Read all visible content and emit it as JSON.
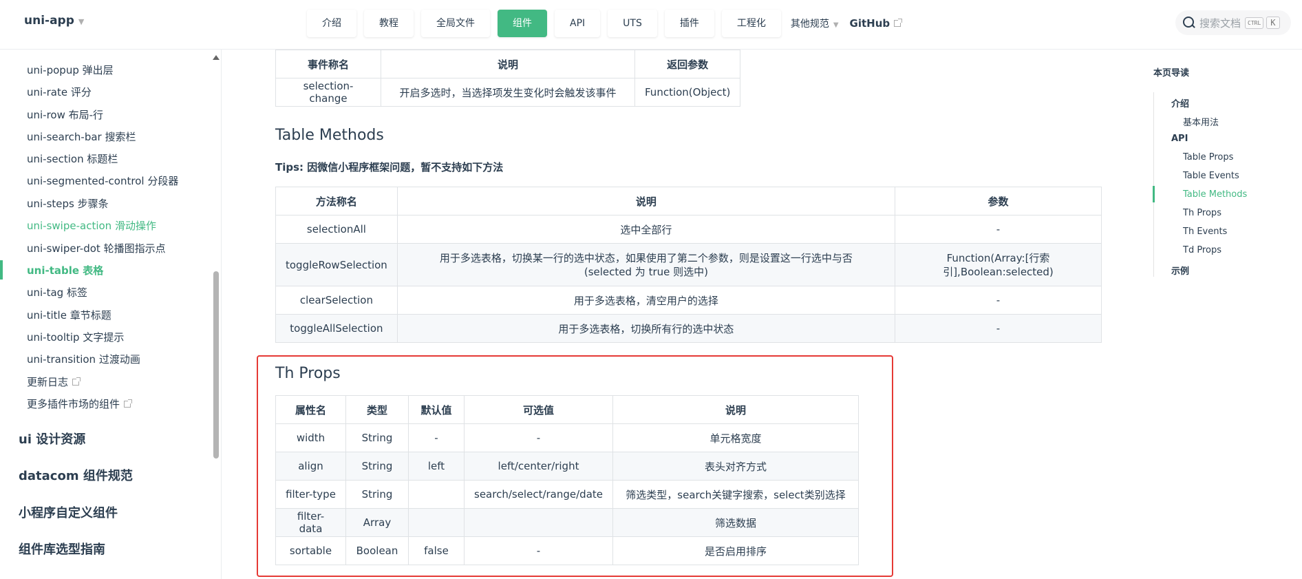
{
  "brand": {
    "name": "uni-app"
  },
  "nav": {
    "items": [
      {
        "label": "介绍"
      },
      {
        "label": "教程"
      },
      {
        "label": "全局文件"
      },
      {
        "label": "组件",
        "active": true
      },
      {
        "label": "API"
      },
      {
        "label": "UTS"
      },
      {
        "label": "插件"
      },
      {
        "label": "工程化"
      }
    ],
    "other_label": "其他规范",
    "github_label": "GitHub"
  },
  "search": {
    "placeholder": "搜索文档",
    "kbd_ctrl": "CTRL",
    "kbd_k": "K"
  },
  "sidebar": {
    "items": [
      "uni-popup 弹出层",
      "uni-rate 评分",
      "uni-row 布局-行",
      "uni-search-bar 搜索栏",
      "uni-section 标题栏",
      "uni-segmented-control 分段器",
      "uni-steps 步骤条",
      "uni-swipe-action 滑动操作",
      "uni-swiper-dot 轮播图指示点",
      "uni-table 表格",
      "uni-tag 标签",
      "uni-title 章节标题",
      "uni-tooltip 文字提示",
      "uni-transition 过渡动画",
      "更新日志",
      "更多插件市场的组件"
    ],
    "groups": [
      "ui 设计资源",
      "datacom 组件规范",
      "小程序自定义组件",
      "组件库选型指南"
    ]
  },
  "events_table": {
    "headers": [
      "事件称名",
      "说明",
      "返回参数"
    ],
    "rows": [
      [
        "selection-change",
        "开启多选时，当选择项发生变化时会触发该事件",
        "Function(Object)"
      ]
    ]
  },
  "methods": {
    "heading": "Table Methods",
    "tips": "Tips: 因微信小程序框架问题，暂不支持如下方法",
    "headers": [
      "方法称名",
      "说明",
      "参数"
    ],
    "rows": [
      [
        "selectionAll",
        "选中全部行",
        "-"
      ],
      [
        "toggleRowSelection",
        "用于多选表格，切换某一行的选中状态，如果使用了第二个参数，则是设置这一行选中与否(selected 为 true 则选中)",
        "Function(Array:[行索引],Boolean:selected)"
      ],
      [
        "clearSelection",
        "用于多选表格，清空用户的选择",
        "-"
      ],
      [
        "toggleAllSelection",
        "用于多选表格，切换所有行的选中状态",
        "-"
      ]
    ]
  },
  "th_props": {
    "heading": "Th Props",
    "headers": [
      "属性名",
      "类型",
      "默认值",
      "可选值",
      "说明"
    ],
    "rows": [
      [
        "width",
        "String",
        "-",
        "-",
        "单元格宽度"
      ],
      [
        "align",
        "String",
        "left",
        "left/center/right",
        "表头对齐方式"
      ],
      [
        "filter-type",
        "String",
        "",
        "search/select/range/date",
        "筛选类型，search关键字搜索，select类别选择"
      ],
      [
        "filter-data",
        "Array",
        "",
        "",
        "筛选数据"
      ],
      [
        "sortable",
        "Boolean",
        "false",
        "-",
        "是否启用排序"
      ]
    ]
  },
  "toc": {
    "title": "本页导读",
    "items": [
      {
        "label": "介绍",
        "level": 1
      },
      {
        "label": "基本用法",
        "level": 2
      },
      {
        "label": "API",
        "level": 1
      },
      {
        "label": "Table Props",
        "level": 2
      },
      {
        "label": "Table Events",
        "level": 2
      },
      {
        "label": "Table Methods",
        "level": 2,
        "active": true
      },
      {
        "label": "Th Props",
        "level": 2
      },
      {
        "label": "Th Events",
        "level": 2
      },
      {
        "label": "Td Props",
        "level": 2
      },
      {
        "label": "示例",
        "level": 1
      }
    ]
  },
  "colors": {
    "accent": "#42b983",
    "highlight": "#e53935",
    "text": "#2c3e50"
  }
}
